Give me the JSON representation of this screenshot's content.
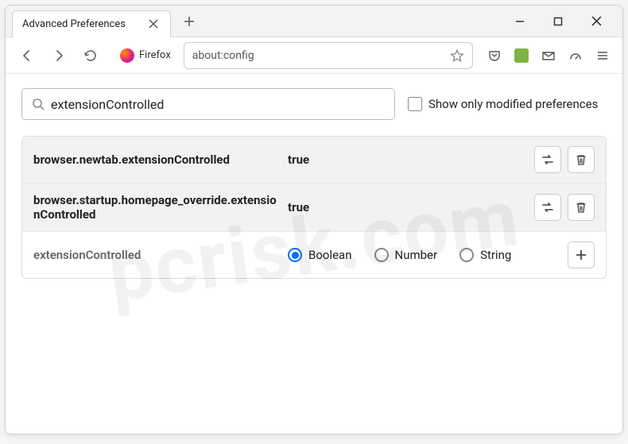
{
  "window": {
    "tab_title": "Advanced Preferences"
  },
  "toolbar": {
    "identity_label": "Firefox",
    "url": "about:config"
  },
  "config": {
    "search_value": "extensionControlled",
    "show_modified_label": "Show only modified preferences",
    "prefs": [
      {
        "name": "browser.newtab.extensionControlled",
        "value": "true",
        "modified": true
      },
      {
        "name": "browser.startup.homepage_override.extensionControlled",
        "value": "true",
        "modified": true
      }
    ],
    "new_pref": {
      "name": "extensionControlled",
      "type_options": [
        "Boolean",
        "Number",
        "String"
      ],
      "selected_type": "Boolean"
    }
  },
  "watermark": "pcrisk.com"
}
